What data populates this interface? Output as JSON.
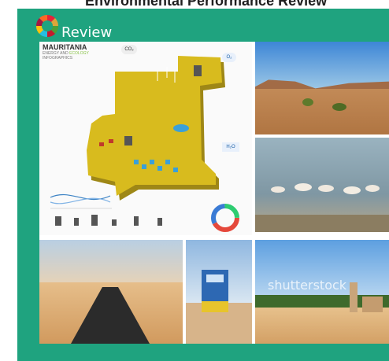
{
  "page": {
    "top_title": "Environmental Performance Review"
  },
  "header": {
    "label": "Review",
    "logo": "sdg-wheel-icon"
  },
  "infographic": {
    "title": "MAURITANIA",
    "subtitle_energy": "ENERGY AND",
    "subtitle_ecology": "ECOLOGY",
    "subtitle_rest": "INFOGRAPHICS",
    "co2": "CO₂",
    "o2": "O₂",
    "h2o": "H₂O"
  },
  "photos": {
    "watermark": "shutterstock"
  },
  "colors": {
    "panel": "#1fa37f",
    "map_yellow": "#d8bb1e",
    "sand": "#d9a56a",
    "sky": "#9cc7e6"
  }
}
